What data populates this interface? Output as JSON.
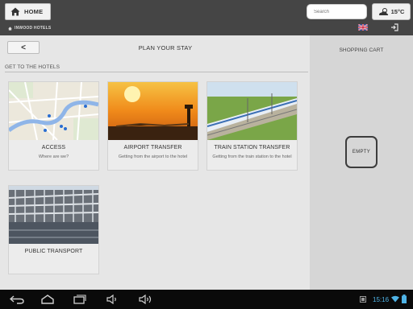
{
  "header": {
    "home_label": "HOME",
    "brand": "INWOOD HOTELS",
    "search_placeholder": "Search",
    "temperature": "15°C"
  },
  "main": {
    "back_label": "<",
    "page_title": "PLAN YOUR STAY",
    "section_title": "GET TO THE HOTELS",
    "cards": [
      {
        "title": "ACCESS",
        "subtitle": "Where are we?"
      },
      {
        "title": "AIRPORT TRANSFER",
        "subtitle": "Getting from the airport to the hotel"
      },
      {
        "title": "TRAIN STATION TRANSFER",
        "subtitle": "Getting from the train station to the hotel"
      },
      {
        "title": "PUBLIC TRANSPORT",
        "subtitle": ""
      }
    ]
  },
  "cart": {
    "title": "SHOPPING CART",
    "empty_label": "EMPTY"
  },
  "status": {
    "time": "15:16"
  },
  "colors": {
    "topbar": "#454545",
    "cart_bg": "#d6d6d6",
    "clock": "#4fb3e6"
  }
}
